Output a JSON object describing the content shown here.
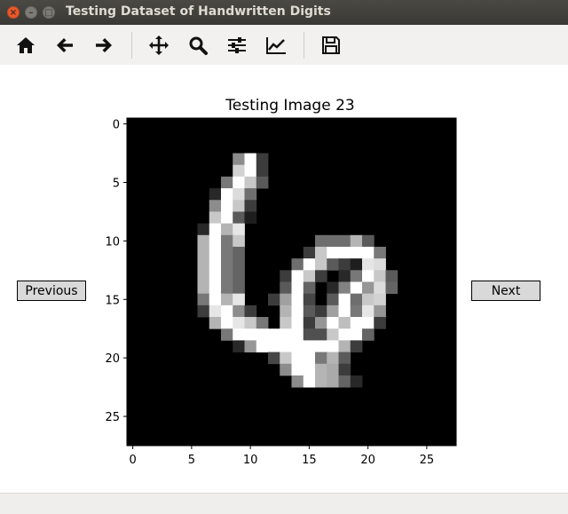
{
  "window": {
    "title": "Testing Dataset of Handwritten Digits"
  },
  "toolbar": {
    "buttons": [
      {
        "name": "home-icon"
      },
      {
        "name": "back-arrow-icon"
      },
      {
        "name": "forward-arrow-icon"
      },
      {
        "name": "pan-icon"
      },
      {
        "name": "zoom-icon"
      },
      {
        "name": "configure-subplots-icon"
      },
      {
        "name": "edit-axis-icon"
      },
      {
        "name": "save-icon"
      }
    ]
  },
  "plot": {
    "title": "Testing Image 23",
    "x_ticks": [
      "0",
      "5",
      "10",
      "15",
      "20",
      "25"
    ],
    "y_ticks": [
      "0",
      "5",
      "10",
      "15",
      "20",
      "25"
    ]
  },
  "nav": {
    "previous_label": "Previous",
    "next_label": "Next"
  },
  "chart_data": {
    "type": "heatmap",
    "title": "Testing Image 23",
    "colormap": "gray",
    "rows": 28,
    "cols": 28,
    "xlim": [
      -0.5,
      27.5
    ],
    "ylim": [
      27.5,
      -0.5
    ],
    "pixels": [
      [
        3,
        9,
        140
      ],
      [
        3,
        10,
        255
      ],
      [
        3,
        11,
        60
      ],
      [
        4,
        9,
        210
      ],
      [
        4,
        10,
        255
      ],
      [
        4,
        11,
        60
      ],
      [
        5,
        8,
        120
      ],
      [
        5,
        9,
        255
      ],
      [
        5,
        10,
        200
      ],
      [
        5,
        11,
        90
      ],
      [
        6,
        7,
        40
      ],
      [
        6,
        8,
        255
      ],
      [
        6,
        9,
        220
      ],
      [
        6,
        10,
        110
      ],
      [
        7,
        7,
        140
      ],
      [
        7,
        8,
        255
      ],
      [
        7,
        9,
        200
      ],
      [
        7,
        10,
        60
      ],
      [
        8,
        7,
        200
      ],
      [
        8,
        8,
        255
      ],
      [
        8,
        9,
        90
      ],
      [
        8,
        10,
        30
      ],
      [
        9,
        6,
        40
      ],
      [
        9,
        7,
        255
      ],
      [
        9,
        8,
        180
      ],
      [
        9,
        9,
        230
      ],
      [
        10,
        6,
        180
      ],
      [
        10,
        7,
        255
      ],
      [
        10,
        8,
        120
      ],
      [
        10,
        9,
        200
      ],
      [
        10,
        16,
        110
      ],
      [
        10,
        17,
        110
      ],
      [
        10,
        18,
        110
      ],
      [
        10,
        19,
        180
      ],
      [
        10,
        20,
        90
      ],
      [
        11,
        6,
        180
      ],
      [
        11,
        7,
        255
      ],
      [
        11,
        8,
        120
      ],
      [
        11,
        9,
        100
      ],
      [
        11,
        15,
        60
      ],
      [
        11,
        16,
        200
      ],
      [
        11,
        17,
        255
      ],
      [
        11,
        18,
        255
      ],
      [
        11,
        19,
        255
      ],
      [
        11,
        20,
        255
      ],
      [
        11,
        21,
        120
      ],
      [
        12,
        6,
        180
      ],
      [
        12,
        7,
        255
      ],
      [
        12,
        8,
        120
      ],
      [
        12,
        9,
        100
      ],
      [
        12,
        14,
        110
      ],
      [
        12,
        15,
        255
      ],
      [
        12,
        16,
        200
      ],
      [
        12,
        17,
        90
      ],
      [
        12,
        18,
        60
      ],
      [
        12,
        19,
        30
      ],
      [
        12,
        20,
        230
      ],
      [
        12,
        21,
        220
      ],
      [
        13,
        6,
        180
      ],
      [
        13,
        7,
        255
      ],
      [
        13,
        8,
        120
      ],
      [
        13,
        9,
        100
      ],
      [
        13,
        13,
        60
      ],
      [
        13,
        14,
        255
      ],
      [
        13,
        15,
        200
      ],
      [
        13,
        16,
        60
      ],
      [
        13,
        18,
        40
      ],
      [
        13,
        19,
        120
      ],
      [
        13,
        20,
        255
      ],
      [
        13,
        21,
        200
      ],
      [
        13,
        22,
        90
      ],
      [
        14,
        6,
        180
      ],
      [
        14,
        7,
        255
      ],
      [
        14,
        8,
        120
      ],
      [
        14,
        9,
        100
      ],
      [
        14,
        13,
        90
      ],
      [
        14,
        14,
        255
      ],
      [
        14,
        15,
        100
      ],
      [
        14,
        17,
        40
      ],
      [
        14,
        18,
        130
      ],
      [
        14,
        19,
        255
      ],
      [
        14,
        20,
        150
      ],
      [
        14,
        21,
        220
      ],
      [
        14,
        22,
        100
      ],
      [
        15,
        6,
        120
      ],
      [
        15,
        7,
        255
      ],
      [
        15,
        8,
        180
      ],
      [
        15,
        9,
        230
      ],
      [
        15,
        12,
        60
      ],
      [
        15,
        13,
        160
      ],
      [
        15,
        14,
        255
      ],
      [
        15,
        15,
        70
      ],
      [
        15,
        17,
        90
      ],
      [
        15,
        18,
        255
      ],
      [
        15,
        19,
        110
      ],
      [
        15,
        20,
        200
      ],
      [
        15,
        21,
        210
      ],
      [
        16,
        6,
        60
      ],
      [
        16,
        7,
        230
      ],
      [
        16,
        8,
        255
      ],
      [
        16,
        9,
        140
      ],
      [
        16,
        10,
        60
      ],
      [
        16,
        13,
        180
      ],
      [
        16,
        14,
        255
      ],
      [
        16,
        15,
        90
      ],
      [
        16,
        16,
        60
      ],
      [
        16,
        17,
        160
      ],
      [
        16,
        18,
        255
      ],
      [
        16,
        19,
        120
      ],
      [
        16,
        20,
        230
      ],
      [
        16,
        21,
        150
      ],
      [
        17,
        7,
        180
      ],
      [
        17,
        8,
        255
      ],
      [
        17,
        9,
        230
      ],
      [
        17,
        10,
        200
      ],
      [
        17,
        11,
        120
      ],
      [
        17,
        13,
        200
      ],
      [
        17,
        14,
        255
      ],
      [
        17,
        15,
        60
      ],
      [
        17,
        16,
        150
      ],
      [
        17,
        17,
        255
      ],
      [
        17,
        18,
        190
      ],
      [
        17,
        19,
        255
      ],
      [
        17,
        20,
        255
      ],
      [
        17,
        21,
        60
      ],
      [
        18,
        8,
        120
      ],
      [
        18,
        9,
        255
      ],
      [
        18,
        10,
        255
      ],
      [
        18,
        11,
        255
      ],
      [
        18,
        12,
        255
      ],
      [
        18,
        13,
        255
      ],
      [
        18,
        14,
        255
      ],
      [
        18,
        15,
        80
      ],
      [
        18,
        16,
        80
      ],
      [
        18,
        17,
        200
      ],
      [
        18,
        18,
        255
      ],
      [
        18,
        19,
        255
      ],
      [
        18,
        20,
        100
      ],
      [
        19,
        9,
        40
      ],
      [
        19,
        10,
        150
      ],
      [
        19,
        11,
        255
      ],
      [
        19,
        12,
        255
      ],
      [
        19,
        13,
        255
      ],
      [
        19,
        14,
        255
      ],
      [
        19,
        15,
        255
      ],
      [
        19,
        16,
        255
      ],
      [
        19,
        17,
        255
      ],
      [
        19,
        18,
        180
      ],
      [
        19,
        19,
        60
      ],
      [
        20,
        12,
        70
      ],
      [
        20,
        13,
        200
      ],
      [
        20,
        14,
        255
      ],
      [
        20,
        15,
        255
      ],
      [
        20,
        16,
        120
      ],
      [
        20,
        17,
        180
      ],
      [
        20,
        18,
        90
      ],
      [
        21,
        13,
        140
      ],
      [
        21,
        14,
        255
      ],
      [
        21,
        15,
        255
      ],
      [
        21,
        16,
        180
      ],
      [
        21,
        17,
        170
      ],
      [
        21,
        18,
        60
      ],
      [
        22,
        14,
        140
      ],
      [
        22,
        15,
        255
      ],
      [
        22,
        16,
        180
      ],
      [
        22,
        17,
        170
      ],
      [
        22,
        18,
        100
      ],
      [
        22,
        19,
        40
      ]
    ]
  }
}
